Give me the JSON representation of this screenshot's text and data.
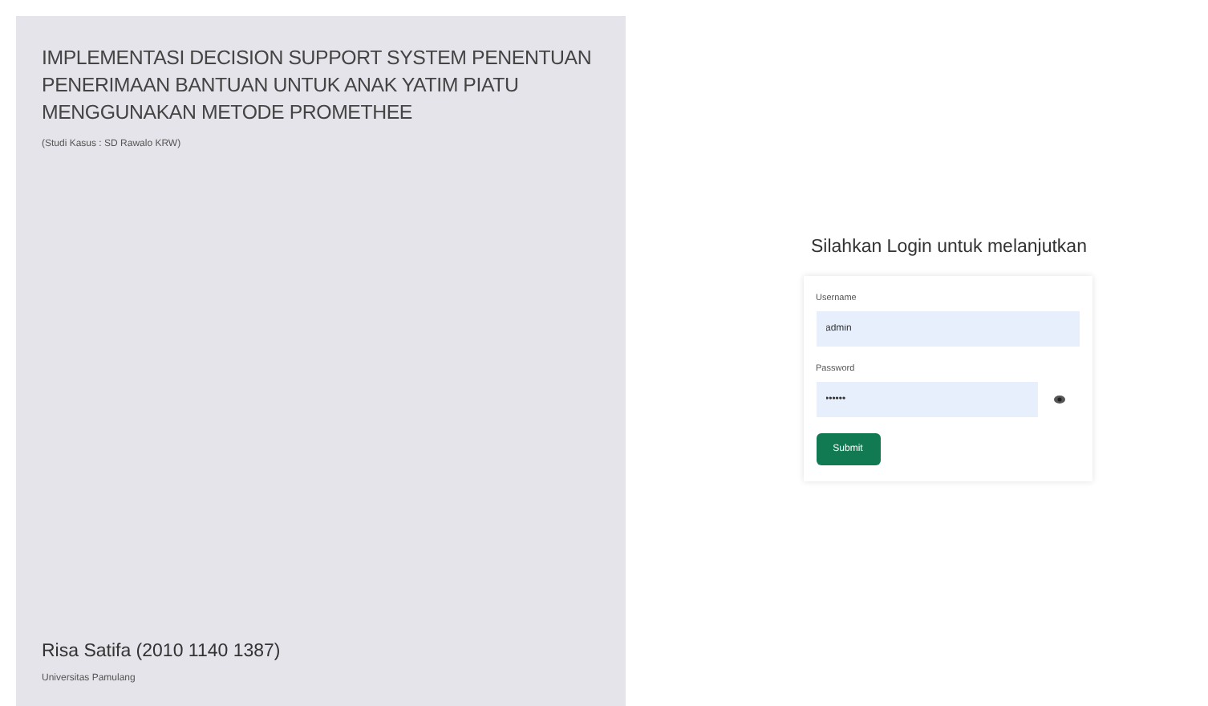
{
  "info_panel": {
    "title": "IMPLEMENTASI DECISION SUPPORT SYSTEM PENENTUAN PENERIMAAN BANTUAN UNTUK ANAK YATIM PIATU MENGGUNAKAN METODE PROMETHEE",
    "subtitle": "(Studi Kasus : SD Rawalo KRW)",
    "author": "Risa Satifa (2010 1140 1387)",
    "institution": "Universitas Pamulang"
  },
  "login": {
    "heading": "Silahkan Login untuk melanjutkan",
    "fields": [
      {
        "label": "Username",
        "value": "admin",
        "kind": "text"
      },
      {
        "label": "Password",
        "value": "••••••",
        "kind": "password"
      }
    ],
    "submit": "Submit"
  }
}
